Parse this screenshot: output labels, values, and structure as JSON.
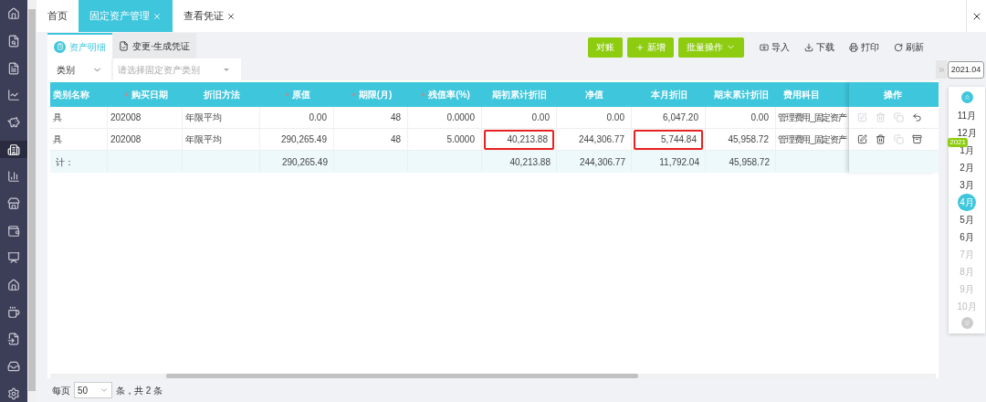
{
  "sidebar": {
    "items": [
      {
        "selected": false
      },
      {
        "selected": false
      },
      {
        "selected": false
      },
      {
        "selected": false
      },
      {
        "selected": false
      },
      {
        "selected": true
      },
      {
        "selected": false
      },
      {
        "selected": false
      },
      {
        "selected": false
      },
      {
        "selected": false
      },
      {
        "selected": false
      },
      {
        "selected": false
      },
      {
        "selected": false
      },
      {
        "selected": false
      },
      {
        "selected": false
      }
    ]
  },
  "tabs": [
    {
      "label": "首页",
      "selected": false,
      "closable": false
    },
    {
      "label": "固定资产管理",
      "selected": true,
      "closable": true
    },
    {
      "label": "查看凭证",
      "selected": false,
      "closable": true
    }
  ],
  "subtabs": [
    {
      "label": "资产明细",
      "selected": true,
      "kind": "list"
    },
    {
      "label": "变更·生成凭证",
      "selected": false,
      "kind": "voucher"
    }
  ],
  "toolbar": {
    "buttons": [
      {
        "label": "对账",
        "kind": "plain"
      },
      {
        "label": "新增",
        "kind": "add"
      },
      {
        "label": "批量操作",
        "kind": "menu"
      }
    ],
    "actions": [
      {
        "label": "导入",
        "kind": "import"
      },
      {
        "label": "下载",
        "kind": "download"
      },
      {
        "label": "打印",
        "kind": "print"
      },
      {
        "label": "刷新",
        "kind": "refresh"
      }
    ]
  },
  "filter": {
    "field": "类别",
    "placeholder": "请选择固定资产类别"
  },
  "table": {
    "columns": [
      {
        "label": "类别名称",
        "required": false
      },
      {
        "label": "购买日期",
        "required": true
      },
      {
        "label": "折旧方法",
        "required": false
      },
      {
        "label": "原值",
        "required": true
      },
      {
        "label": "期限(月)",
        "required": true
      },
      {
        "label": "残值率(%)",
        "required": true
      },
      {
        "label": "期初累计折旧",
        "required": false
      },
      {
        "label": "净值",
        "required": false
      },
      {
        "label": "本月折旧",
        "required": false
      },
      {
        "label": "期末累计折旧",
        "required": false
      },
      {
        "label": "费用科目",
        "required": false
      }
    ],
    "actions_column": "操作",
    "rows": [
      {
        "cells": [
          {
            "text": "具",
            "highlighted": false
          },
          {
            "text": "202008",
            "highlighted": false
          },
          {
            "text": "年限平均",
            "highlighted": false
          },
          {
            "text": "0.00",
            "highlighted": false
          },
          {
            "text": "48",
            "highlighted": false
          },
          {
            "text": "0.0000",
            "highlighted": false
          },
          {
            "text": "0.00",
            "highlighted": false
          },
          {
            "text": "0.00",
            "highlighted": false
          },
          {
            "text": "6,047.20",
            "highlighted": false
          },
          {
            "text": "0.00",
            "highlighted": false
          },
          {
            "text": "管理费用_固定资产",
            "highlighted": false
          }
        ],
        "actions": [
          {
            "kind": "edit",
            "disabled": true
          },
          {
            "kind": "delete",
            "disabled": true
          },
          {
            "kind": "copy",
            "disabled": true
          },
          {
            "kind": "undo",
            "disabled": false
          }
        ]
      },
      {
        "cells": [
          {
            "text": "具",
            "highlighted": false
          },
          {
            "text": "202008",
            "highlighted": false
          },
          {
            "text": "年限平均",
            "highlighted": false
          },
          {
            "text": "290,265.49",
            "highlighted": false
          },
          {
            "text": "48",
            "highlighted": false
          },
          {
            "text": "5.0000",
            "highlighted": false
          },
          {
            "text": "40,213.88",
            "highlighted": true
          },
          {
            "text": "244,306.77",
            "highlighted": false
          },
          {
            "text": "5,744.84",
            "highlighted": true
          },
          {
            "text": "45,958.72",
            "highlighted": false
          },
          {
            "text": "管理费用_固定资产",
            "highlighted": false
          }
        ],
        "actions": [
          {
            "kind": "edit",
            "disabled": false
          },
          {
            "kind": "delete",
            "disabled": false
          },
          {
            "kind": "copy",
            "disabled": true
          },
          {
            "kind": "dispose",
            "disabled": false
          }
        ]
      }
    ],
    "total": {
      "label": "计：",
      "original_value": "290,265.49",
      "opening_depreciation": "40,213.88",
      "net_value": "244,306.77",
      "month_depreciation": "11,792.04",
      "closing_depreciation": "45,958.72"
    }
  },
  "pagination": {
    "label": "每页",
    "page_size": "50",
    "summary": "条，共 2 条"
  },
  "period": {
    "value": "2021.04",
    "months": [
      {
        "label": "11月",
        "selected": false,
        "disabled": false
      },
      {
        "label": "12月",
        "selected": false,
        "disabled": false
      },
      {
        "label": "1月",
        "selected": false,
        "disabled": false,
        "badge": "2021"
      },
      {
        "label": "2月",
        "selected": false,
        "disabled": false
      },
      {
        "label": "3月",
        "selected": false,
        "disabled": false
      },
      {
        "label": "4月",
        "selected": true,
        "disabled": false
      },
      {
        "label": "5月",
        "selected": false,
        "disabled": false
      },
      {
        "label": "6月",
        "selected": false,
        "disabled": false
      },
      {
        "label": "7月",
        "selected": false,
        "disabled": true
      },
      {
        "label": "8月",
        "selected": false,
        "disabled": true
      },
      {
        "label": "9月",
        "selected": false,
        "disabled": true
      },
      {
        "label": "10月",
        "selected": false,
        "disabled": true
      }
    ]
  }
}
